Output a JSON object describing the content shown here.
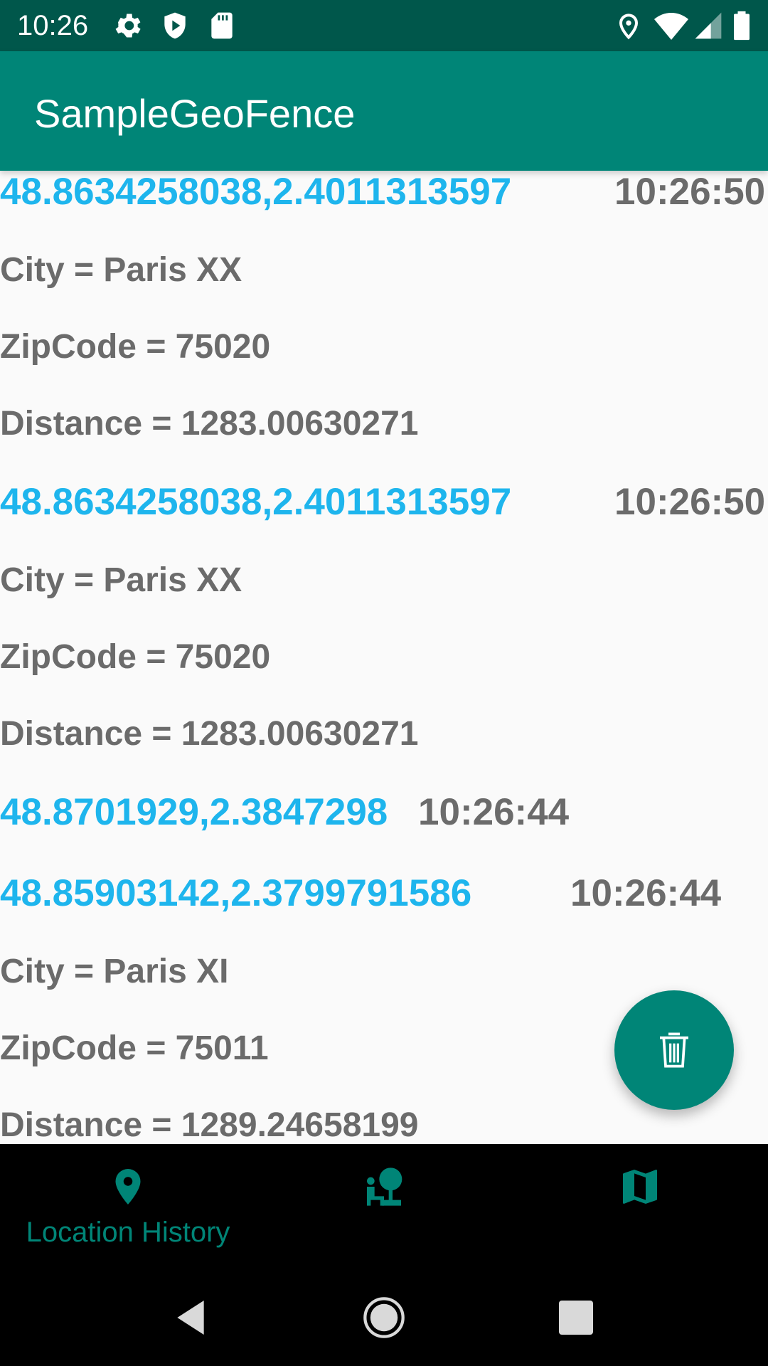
{
  "status_bar": {
    "time": "10:26",
    "left_icons": [
      "gear-icon",
      "shield-icon",
      "sd-card-icon"
    ],
    "right_icons": [
      "location-icon",
      "wifi-icon",
      "signal-icon",
      "battery-icon"
    ]
  },
  "app_bar": {
    "title": "SampleGeoFence"
  },
  "entries": [
    {
      "coords": "48.8634258038,2.4011313597",
      "time": "10:26:50",
      "city": "City = Paris XX",
      "zip": "ZipCode = 75020",
      "distance": "Distance = 1283.00630271"
    },
    {
      "coords": "48.8634258038,2.4011313597",
      "time": "10:26:50",
      "city": "City = Paris XX",
      "zip": "ZipCode = 75020",
      "distance": "Distance = 1283.00630271"
    },
    {
      "coords": "48.8701929,2.3847298",
      "time": "10:26:44"
    },
    {
      "coords": "48.85903142,2.3799791586",
      "time": "10:26:44",
      "city": "City = Paris XI",
      "zip": "ZipCode = 75011",
      "distance": "Distance = 1289.24658199"
    }
  ],
  "fab": {
    "icon": "trash-icon"
  },
  "bottom_nav": {
    "items": [
      {
        "label": "Location History",
        "icon": "location-pin-icon",
        "active": true
      },
      {
        "icon": "person-tree-icon"
      },
      {
        "icon": "map-icon"
      }
    ],
    "active_color": "#008577"
  },
  "colors": {
    "primary": "#008577",
    "primary_dark": "#00574b",
    "coordinate_text": "#1eb5ed",
    "secondary_text": "#6b6b6b"
  }
}
